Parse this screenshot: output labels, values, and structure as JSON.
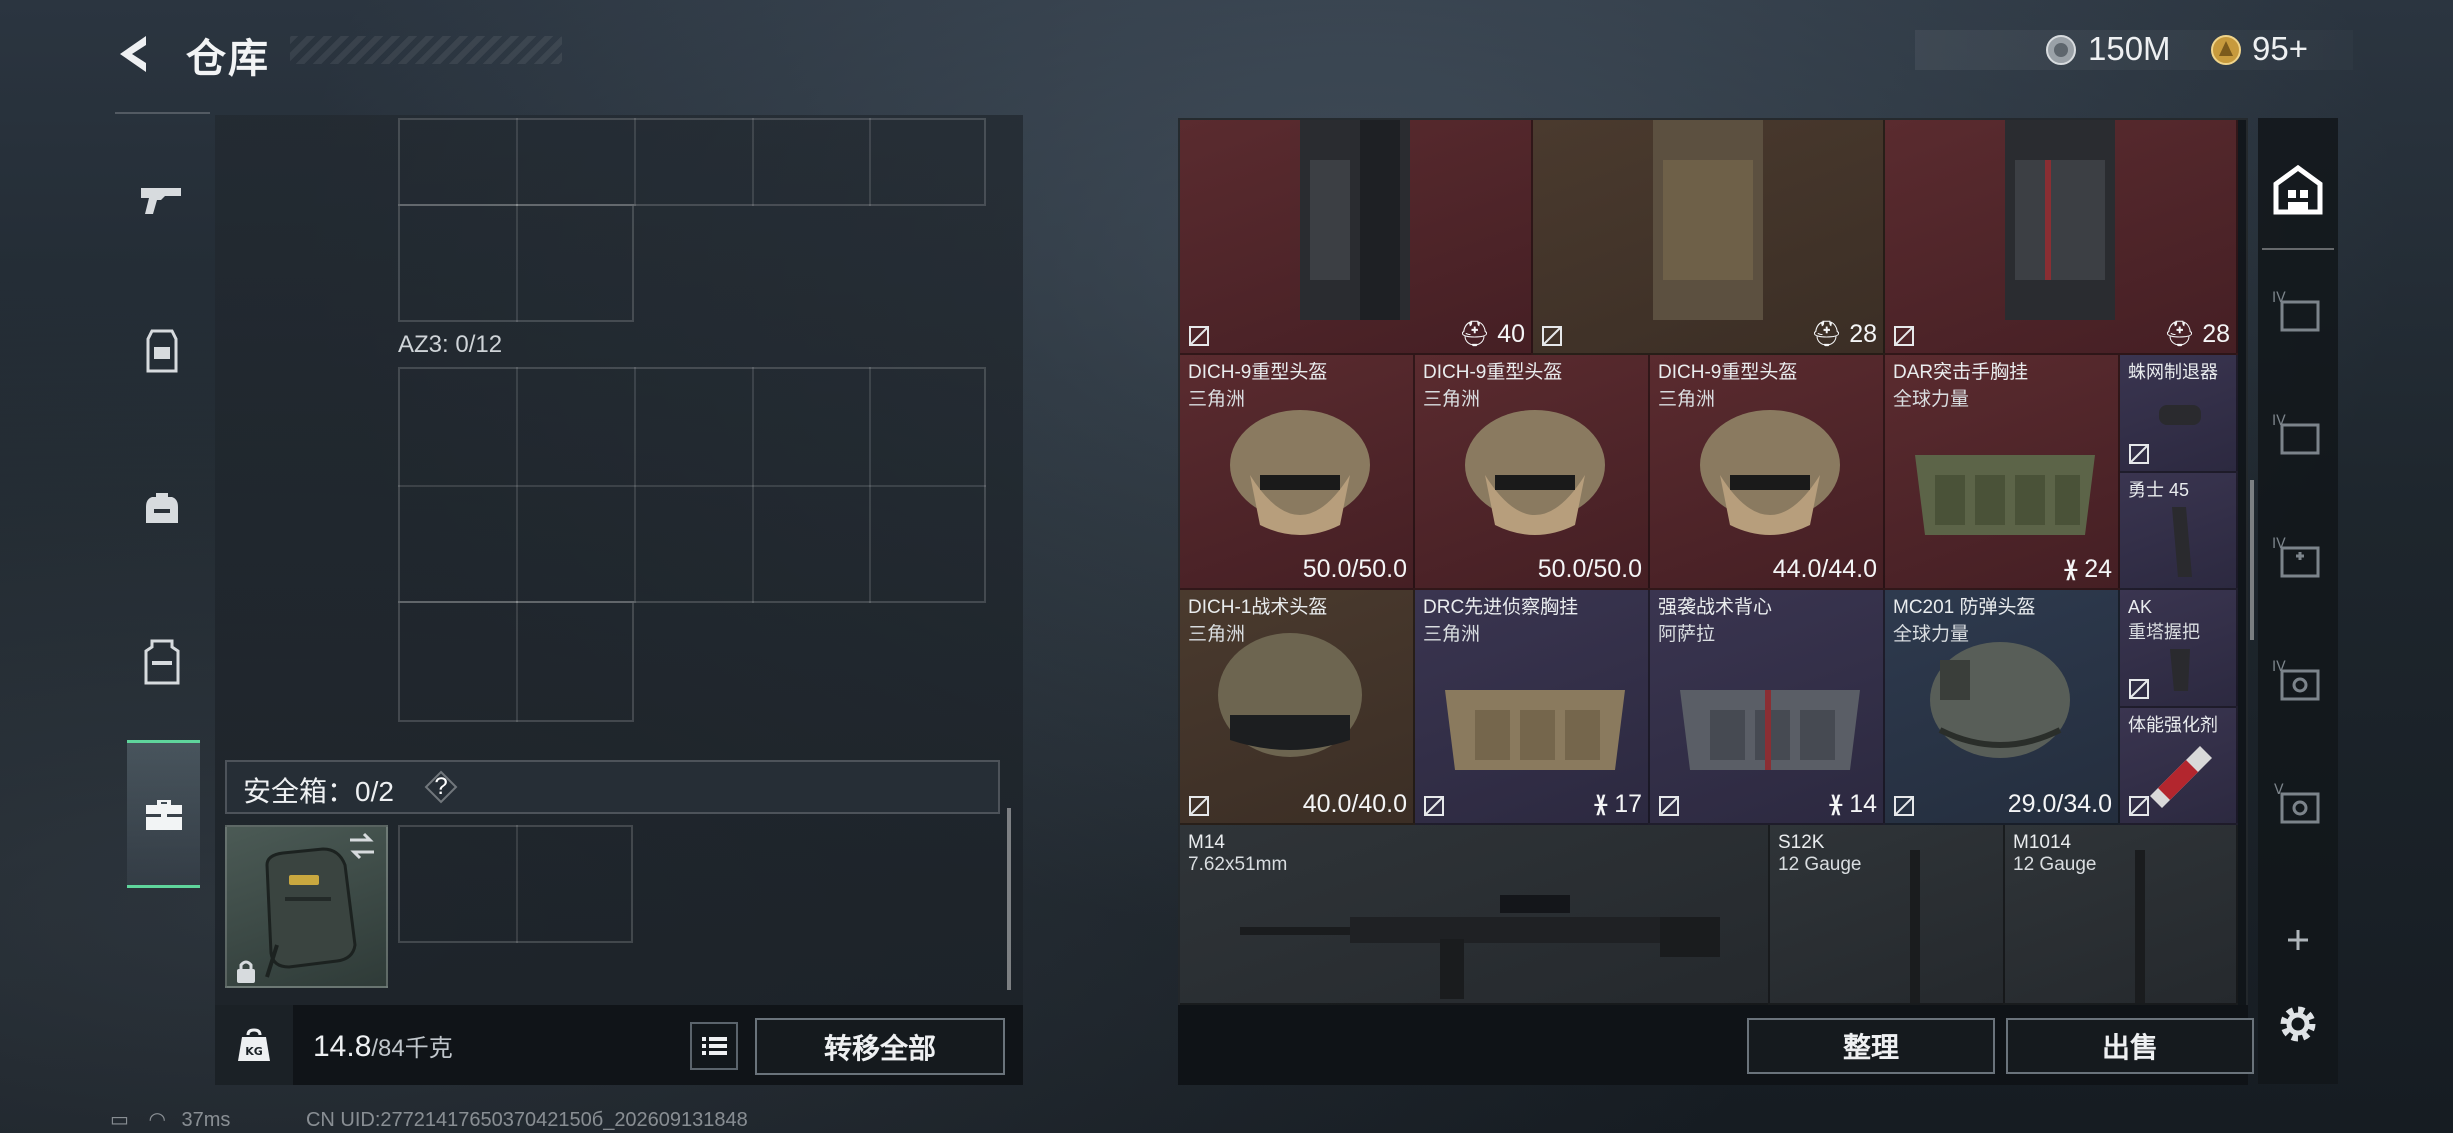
{
  "header": {
    "title": "仓库",
    "currency": [
      {
        "icon": "silver-coin-icon",
        "value": "150M",
        "color": "#c9cdd1"
      },
      {
        "icon": "gold-coin-icon",
        "value": "95+",
        "color": "#d8b35a"
      }
    ]
  },
  "left_tabs": [
    {
      "name": "weapon",
      "icon": "pistol-icon"
    },
    {
      "name": "armor",
      "icon": "chest-rig-icon"
    },
    {
      "name": "backpack",
      "icon": "backpack-icon"
    },
    {
      "name": "vest",
      "icon": "vest-icon"
    },
    {
      "name": "safebox",
      "icon": "briefcase-icon",
      "active": true
    }
  ],
  "left_panel": {
    "az3_label": "AZ3: 0/12",
    "safebox_label": "安全箱：0/2",
    "safebox_help": "?",
    "weight": "14.8",
    "weight_max": "/84千克",
    "transfer_all": "转移全部"
  },
  "accent_color": "#5fd59c",
  "grid_items": [
    {
      "id": "rig-1",
      "name": "",
      "sub": "",
      "value": "40",
      "value_icon": "helmet-small-icon",
      "rarity": "red"
    },
    {
      "id": "rig-2",
      "name": "",
      "sub": "",
      "value": "28",
      "value_icon": "helmet-small-icon",
      "rarity": "gold"
    },
    {
      "id": "rig-3",
      "name": "",
      "sub": "",
      "value": "28",
      "value_icon": "helmet-small-icon",
      "rarity": "red"
    },
    {
      "id": "h1",
      "name": "DICH-9重型头盔",
      "sub": "三角洲",
      "value": "50.0/50.0",
      "rarity": "red"
    },
    {
      "id": "h2",
      "name": "DICH-9重型头盔",
      "sub": "三角洲",
      "value": "50.0/50.0",
      "rarity": "red"
    },
    {
      "id": "h3",
      "name": "DICH-9重型头盔",
      "sub": "三角洲",
      "value": "44.0/44.0",
      "rarity": "red"
    },
    {
      "id": "dar",
      "name": "DAR突击手胸挂",
      "sub": "全球力量",
      "value": "24",
      "value_icon": "vest-small-icon",
      "rarity": "red"
    },
    {
      "id": "spider",
      "name": "蛛网制退器",
      "sub": "",
      "value": "",
      "rarity": "purple"
    },
    {
      "id": "yongshi",
      "name": "勇士 45",
      "sub": "",
      "value": "",
      "rarity": "purple"
    },
    {
      "id": "dich1",
      "name": "DICH-1战术头盔",
      "sub": "三角洲",
      "value": "40.0/40.0",
      "rarity": "gold"
    },
    {
      "id": "drc",
      "name": "DRC先进侦察胸挂",
      "sub": "三角洲",
      "value": "17",
      "value_icon": "vest-small-icon",
      "rarity": "purple"
    },
    {
      "id": "qx",
      "name": "强袭战术背心",
      "sub": "阿萨拉",
      "value": "14",
      "value_icon": "vest-small-icon",
      "rarity": "purple"
    },
    {
      "id": "mc201",
      "name": "MC201 防弹头盔",
      "sub": "全球力量",
      "value": "29.0/34.0",
      "rarity": "blue"
    },
    {
      "id": "ak",
      "name": "AK",
      "sub": "重塔握把",
      "value": "",
      "rarity": "purple"
    },
    {
      "id": "tineng",
      "name": "体能强化剂",
      "sub": "",
      "value": "",
      "rarity": "purple"
    },
    {
      "id": "m14",
      "name": "M14",
      "sub": "7.62x51mm",
      "value": "",
      "rarity": "grey"
    },
    {
      "id": "s12k",
      "name": "S12K",
      "sub": "12 Gauge",
      "value": "",
      "rarity": "grey"
    },
    {
      "id": "m1014",
      "name": "M1014",
      "sub": "12 Gauge",
      "value": "",
      "rarity": "grey"
    }
  ],
  "right_buttons": {
    "sort": "整理",
    "sell": "出售"
  },
  "side_icons": [
    {
      "icon": "storage-icon",
      "active": true
    },
    {
      "label": "IV",
      "icon": "crate-icon"
    },
    {
      "label": "IV",
      "icon": "crate-icon"
    },
    {
      "label": "IV",
      "icon": "medical-crate-icon"
    },
    {
      "label": "IV",
      "icon": "tool-crate-icon"
    },
    {
      "label": "V",
      "icon": "tool-crate-icon"
    },
    {
      "icon": "plus-icon"
    },
    {
      "icon": "gear-icon"
    }
  ],
  "status": {
    "ping": "37ms",
    "uid": "CN UID:2772141765037042150б_202609131848"
  }
}
